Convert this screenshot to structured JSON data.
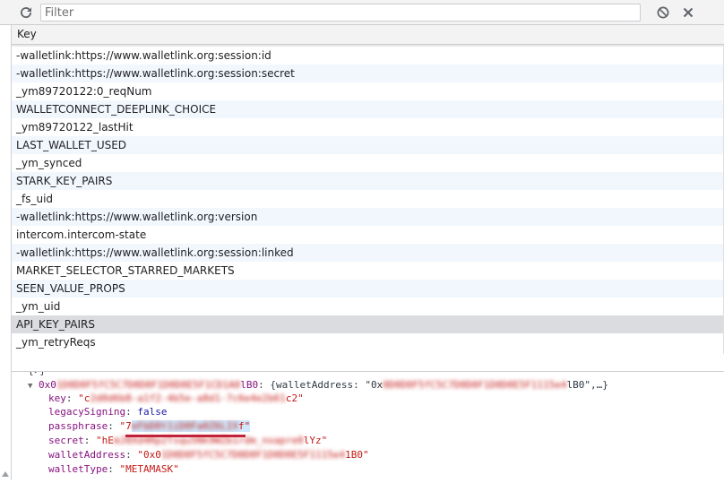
{
  "toolbar": {
    "filter_placeholder": "Filter",
    "refresh_icon": "refresh-icon",
    "clear_all_icon": "clear-all-icon",
    "delete_icon": "close-icon"
  },
  "table": {
    "header_key": "Key",
    "rows": [
      "-walletlink:https://www.walletlink.org:session:id",
      "-walletlink:https://www.walletlink.org:session:secret",
      "_ym89720122:0_reqNum",
      "WALLETCONNECT_DEEPLINK_CHOICE",
      "_ym89720122_lastHit",
      "LAST_WALLET_USED",
      "_ym_synced",
      "STARK_KEY_PAIRS",
      "_fs_uid",
      "-walletlink:https://www.walletlink.org:version",
      "intercom.intercom-state",
      "-walletlink:https://www.walletlink.org:session:linked",
      "MARKET_SELECTOR_STARRED_MARKETS",
      "SEEN_VALUE_PROPS",
      "_ym_uid",
      "API_KEY_PAIRS",
      "_ym_retryReqs"
    ],
    "selected_row": "API_KEY_PAIRS"
  },
  "preview": {
    "top_partial": "{▸}",
    "entry_prefix": "0x0",
    "entry_address_blurred": "1D0D0F5fC5C7D0D0F1D0D0E5F1CD1A0",
    "entry_address_end": "lB0",
    "entry_summary_prefix": ": {walletAddress: \"0x",
    "entry_summary_blurred": "0D0D0F5fC5C7D0D0F1D0D0E5F1115e4",
    "entry_summary_end": "lB0\",…}",
    "fields": [
      {
        "key": "key",
        "prefix": "\"c",
        "blurred": "2d0d6b8-a1f2-4b5e-a8d1-7c6e4e2b61",
        "suffix": "c2\"",
        "type": "string"
      },
      {
        "key": "legacySigning",
        "value": "false",
        "type": "bool"
      },
      {
        "key": "passphrase",
        "prefix": "\"7",
        "blurred": "eFbD0t1iD0Fa0Z6LIX",
        "suffix": "f\"",
        "type": "string",
        "highlighted": true
      },
      {
        "key": "secret",
        "prefix": "\"hE",
        "blurred": "mJ8Xd4Rp2Tsqu5Nk9WZb1rdm_nxapre0",
        "suffix": "lYz\"",
        "type": "string"
      },
      {
        "key": "walletAddress",
        "prefix": "\"0x0",
        "blurred": "1D0D0F5fC5C7D0D0F1D0D0E5F1115e4",
        "suffix": "1B0\"",
        "type": "string"
      },
      {
        "key": "walletType",
        "value": "\"METAMASK\"",
        "type": "string"
      }
    ]
  },
  "colors": {
    "accent": "#1a73e8",
    "selected_row": "#dadce0",
    "zebra_row": "#f2f7fd",
    "string": "#c41a16",
    "key": "#881280",
    "bool": "#1a1aa6",
    "annotation_underline": "#c2213a"
  }
}
